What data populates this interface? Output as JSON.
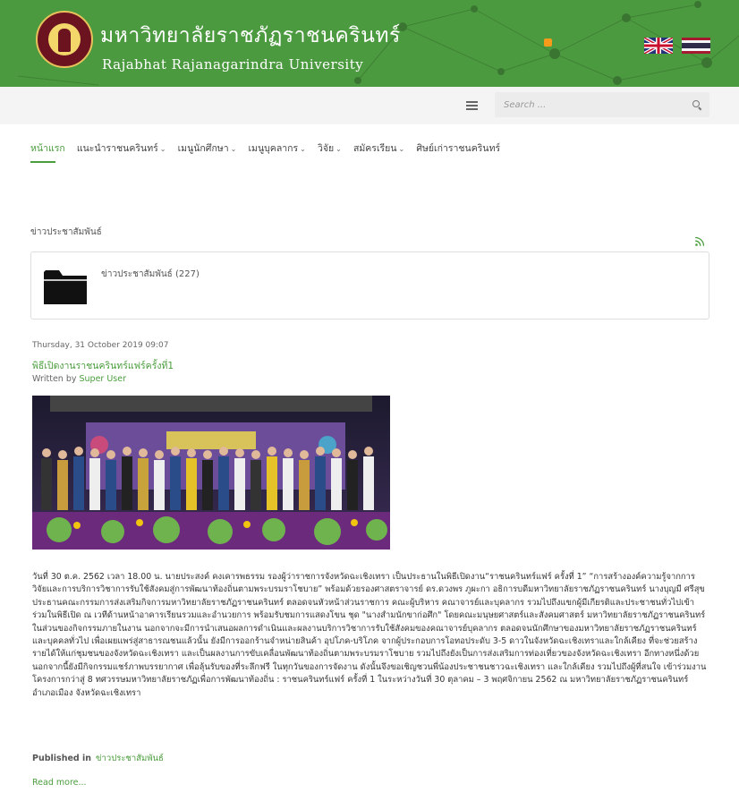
{
  "header": {
    "site_name_th": "มหาวิทยาลัยราชภัฏราชนครินทร์",
    "site_name_en": "Rajabhat Rajanagarindra University",
    "background_color": "#4b9a3f",
    "rss_icon": "rss-icon",
    "languages": [
      "english-flag-icon",
      "thai-flag-icon"
    ]
  },
  "search": {
    "placeholder": "Search ..."
  },
  "nav": {
    "items": [
      {
        "label": "หน้าแรก",
        "active": true,
        "dropdown": false
      },
      {
        "label": "แนะนำราชนครินทร์",
        "active": false,
        "dropdown": true
      },
      {
        "label": "เมนูนักศึกษา",
        "active": false,
        "dropdown": true
      },
      {
        "label": "เมนูบุคลากร",
        "active": false,
        "dropdown": true
      },
      {
        "label": "วิจัย",
        "active": false,
        "dropdown": true
      },
      {
        "label": "สมัครเรียน",
        "active": false,
        "dropdown": true
      },
      {
        "label": "ศิษย์เก่าราชนครินทร์",
        "active": false,
        "dropdown": false
      }
    ],
    "chevron": "⌄"
  },
  "section": {
    "title": "ข่าวประชาสัมพันธ์",
    "category_link": "ข่าวประชาสัมพันธ์ (227)"
  },
  "article": {
    "date": "Thursday, 31 October 2019 09:07",
    "title": "พิธีเปิดงานราชนครินทร์แฟร์ครั้งที่1",
    "written_by_label": "Written by",
    "author": "Super User",
    "paragraphs": [
      "วันที่  30 ต.ค. 2562  เวลา 18.00 น. นายประสงค์ คงเคารพธรรม รองผู้ว่าราชการจังหวัดฉะเชิงเทรา เป็นประธานในพิธีเปิดงาน“ราชนครินทร์แฟร์ ครั้งที่ 1” “การสร้างองค์ความรู้จากการวิจัยและการบริการวิชาการรับใช้สังคมสู่การพัฒนาท้องถิ่นตามพระบรมราโชบาย” พร้อมด้วยรองศาสตราจารย์ ดร.ดวงพร ภูผะกา อธิการบดีมหาวิทยาลัยราชภัฏราชนครินทร์ นางบุญมี ศรีสุข ประธานคณะกรรมการส่งเสริมกิจการมหาวิทยาลัยราชภัฏราชนครินทร์ ตลอดจนหัวหน้าส่วนราชการ คณะผู้บริหาร คณาจารย์และบุคลากร รวมไปถึงแขกผู้มีเกียรติและประชาชนทั่วไปเข้าร่วมในพิธีเปิด ณ เวทีด้านหน้าอาคารเรียนรวมและอำนวยการ พร้อมรับชมการแสดงโขน ชุด \"นางสำมนักขาก่อศึก\" โดยคณะมนุษยศาสตร์และสังคมศาสตร์ มหาวิทยาลัยราชภัฏราชนครินทร์",
      "ในส่วนของกิจกรรมภายในงาน นอกจากจะมีการนำเสนอผลการดำเนินและผลงานบริการวิชาการรับใช้สังคมของคณาจารย์บุคลากร ตลอดจนนักศึกษาของมหาวิทยาลัยราชภัฏราชนครินทร์ และบุคคลทั่วไป เพื่อเผยแพร่สู่สาธารณชนแล้วนั้น ยังมีการออกร้านจำหน่ายสินค้า อุปโภค-บริโภค จากผู้ประกอบการโอทอประดับ 3-5 ดาวในจังหวัดฉะเชิงเทราและใกล้เคียง ที่จะช่วยสร้างรายได้ให้แก่ชุมชนของจังหวัดฉะเชิงเทรา และเป็นผลงานการขับเคลื่อนพัฒนาท้องถิ่นตามพระบรมราโชบาย รวมไปถึงยังเป็นการส่งเสริมการท่องเที่ยวของจังหวัดฉะเชิงเทรา อีกทางหนึ่งด้วย นอกจากนี้ยังมีกิจกรรมแชร์ภาพบรรยากาศ เพื่อลุ้นรับของที่ระลึกฟรี ในทุกวันของการจัดงาน ดังนั้นจึงขอเชิญชวนพี่น้องประชาชนชาวฉะเชิงเทรา และใกล้เคียง รวมไปถึงผู้ที่สนใจ เข้าร่วมงานโครงการกว่าสู่ 8 ทศวรรษมหาวิทยาลัยราชภัฏเพื่อการพัฒนาท้องถิ่น : ราชนครินทร์แฟร์ ครั้งที่ 1 ในระหว่างวันที่ 30 ตุลาคม – 3 พฤศจิกายน 2562 ณ มหาวิทยาลัยราชภัฏราชนครินทร์ อำเภอเมือง จังหวัดฉะเชิงเทรา"
    ],
    "published_in_label": "Published in",
    "published_category": "ข่าวประชาสัมพันธ์",
    "read_more": "Read more..."
  },
  "colors": {
    "accent": "#4a9d3c",
    "topbar": "#f4f4f4"
  }
}
